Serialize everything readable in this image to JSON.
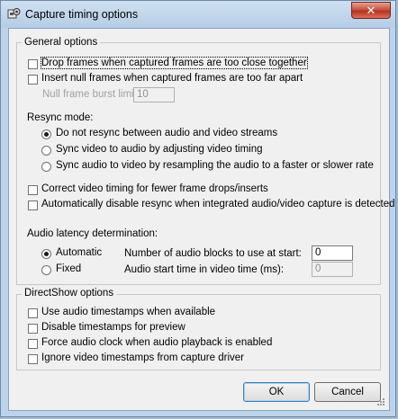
{
  "window": {
    "title": "Capture timing options",
    "close_glyph": "✕"
  },
  "general": {
    "title": "General options",
    "drop_frames": "Drop frames when captured frames are too close together",
    "insert_null": "Insert null frames when captured frames are too far apart",
    "null_burst_label": "Null frame burst limit:",
    "null_burst_value": "10",
    "resync_label": "Resync mode:",
    "resync_options": [
      "Do not resync between audio and video streams",
      "Sync video to audio by adjusting video timing",
      "Sync audio to video by resampling the audio to a faster or slower rate"
    ],
    "resync_selected": 0,
    "correct_timing": "Correct video timing for fewer frame drops/inserts",
    "auto_disable": "Automatically disable resync when integrated audio/video capture is detected",
    "latency_label": "Audio latency determination:",
    "latency_automatic": "Automatic",
    "latency_fixed": "Fixed",
    "latency_selected": "Automatic",
    "blocks_label": "Number of audio blocks to use at start:",
    "blocks_value": "0",
    "start_time_label": "Audio start time in video time (ms):",
    "start_time_value": "0"
  },
  "directshow": {
    "title": "DirectShow options",
    "items": [
      "Use audio timestamps when available",
      "Disable timestamps for preview",
      "Force audio clock when audio playback is enabled",
      "Ignore video timestamps from capture driver"
    ]
  },
  "buttons": {
    "ok": "OK",
    "cancel": "Cancel"
  },
  "colors": {
    "frame": "#bcd3ea",
    "client": "#f0f0f0",
    "close": "#c75342"
  }
}
